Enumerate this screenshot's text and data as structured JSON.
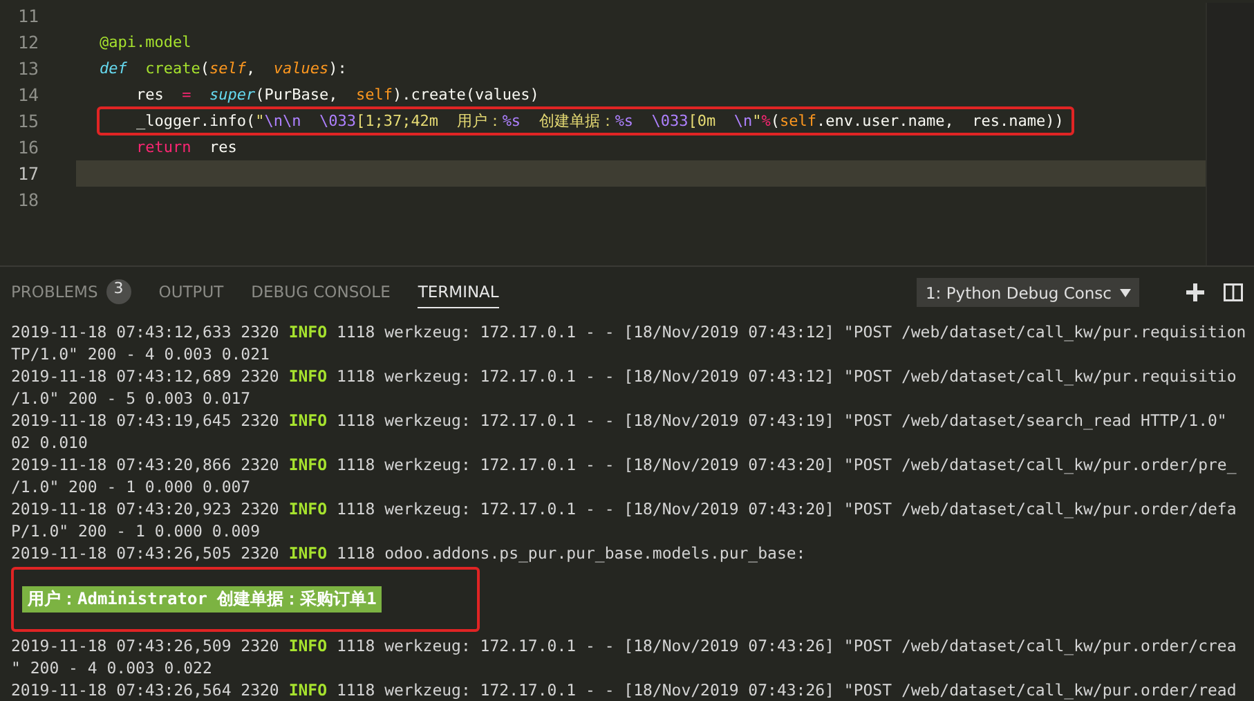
{
  "editor": {
    "lines": [
      {
        "number": "11",
        "current": false
      },
      {
        "number": "12",
        "current": false,
        "tokens": [
          {
            "t": "@api.model",
            "kind": "decorator"
          }
        ]
      },
      {
        "number": "13",
        "current": false,
        "tokens": [
          {
            "t": "def",
            "kind": "storage"
          },
          {
            "t": "  create",
            "kind": "function"
          },
          {
            "t": "(",
            "kind": "plain"
          },
          {
            "t": "self",
            "kind": "param"
          },
          {
            "t": ",  ",
            "kind": "plain"
          },
          {
            "t": "values",
            "kind": "param"
          },
          {
            "t": "):",
            "kind": "plain"
          }
        ]
      },
      {
        "number": "14",
        "current": false,
        "tokens": [
          {
            "t": "    res  ",
            "kind": "plain"
          },
          {
            "t": "=",
            "kind": "operator"
          },
          {
            "t": "  super",
            "kind": "storage"
          },
          {
            "t": "(PurBase,  ",
            "kind": "plain"
          },
          {
            "t": "self",
            "kind": "self"
          },
          {
            "t": ").create(values)",
            "kind": "plain"
          }
        ]
      },
      {
        "number": "15",
        "current": false,
        "highlighted": true,
        "tokens": [
          {
            "t": "    _logger.info(",
            "kind": "plain"
          },
          {
            "t": "\"",
            "kind": "string"
          },
          {
            "t": "\\n\\n  \\033",
            "kind": "escape"
          },
          {
            "t": "[1;37;42m  用户：",
            "kind": "string"
          },
          {
            "t": "%s",
            "kind": "escape"
          },
          {
            "t": "  创建单据：",
            "kind": "string"
          },
          {
            "t": "%s  \\033",
            "kind": "escape"
          },
          {
            "t": "[0m  ",
            "kind": "string"
          },
          {
            "t": "\\n",
            "kind": "escape"
          },
          {
            "t": "\"",
            "kind": "string"
          },
          {
            "t": "%",
            "kind": "operator"
          },
          {
            "t": "(",
            "kind": "plain"
          },
          {
            "t": "self",
            "kind": "self"
          },
          {
            "t": ".env.user.name,  res.name))",
            "kind": "plain"
          }
        ]
      },
      {
        "number": "16",
        "current": false,
        "tokens": [
          {
            "t": "    return",
            "kind": "operator"
          },
          {
            "t": "  res",
            "kind": "plain"
          }
        ]
      },
      {
        "number": "17",
        "current": true
      },
      {
        "number": "18",
        "current": false
      }
    ]
  },
  "panel": {
    "tabs": [
      {
        "label": "PROBLEMS",
        "badge": "3",
        "selected": false
      },
      {
        "label": "OUTPUT",
        "selected": false
      },
      {
        "label": "DEBUG CONSOLE",
        "selected": false
      },
      {
        "label": "TERMINAL",
        "selected": true
      }
    ],
    "terminal_select": "1: Python Debug Consc"
  },
  "terminal": [
    {
      "kind": "log",
      "head": "2019-11-18 07:43:12,633 2320",
      "level": "INFO",
      "rest": "1118 werkzeug: 172.17.0.1 - - [18/Nov/2019 07:43:12] \"POST /web/dataset/call_kw/pur.requisition",
      "wrap": "TP/1.0\" 200 - 4 0.003 0.021"
    },
    {
      "kind": "log",
      "head": "2019-11-18 07:43:12,689 2320",
      "level": "INFO",
      "rest": "1118 werkzeug: 172.17.0.1 - - [18/Nov/2019 07:43:12] \"POST /web/dataset/call_kw/pur.requisitio",
      "wrap": "/1.0\" 200 - 5 0.003 0.017"
    },
    {
      "kind": "log",
      "head": "2019-11-18 07:43:19,645 2320",
      "level": "INFO",
      "rest": "1118 werkzeug: 172.17.0.1 - - [18/Nov/2019 07:43:19] \"POST /web/dataset/search_read HTTP/1.0\"",
      "wrap": "02 0.010"
    },
    {
      "kind": "log",
      "head": "2019-11-18 07:43:20,866 2320",
      "level": "INFO",
      "rest": "1118 werkzeug: 172.17.0.1 - - [18/Nov/2019 07:43:20] \"POST /web/dataset/call_kw/pur.order/pre_",
      "wrap": "/1.0\" 200 - 1 0.000 0.007"
    },
    {
      "kind": "log",
      "head": "2019-11-18 07:43:20,923 2320",
      "level": "INFO",
      "rest": "1118 werkzeug: 172.17.0.1 - - [18/Nov/2019 07:43:20] \"POST /web/dataset/call_kw/pur.order/defa",
      "wrap": "P/1.0\" 200 - 1 0.000 0.009"
    },
    {
      "kind": "log",
      "head": "2019-11-18 07:43:26,505 2320",
      "level": "INFO",
      "rest": "1118 odoo.addons.ps_pur.pur_base.models.pur_base:"
    },
    {
      "kind": "banner",
      "text": "用户：Administrator 创建单据：采购订单1",
      "highlighted": true
    },
    {
      "kind": "log",
      "head": "2019-11-18 07:43:26,509 2320",
      "level": "INFO",
      "rest": "1118 werkzeug: 172.17.0.1 - - [18/Nov/2019 07:43:26] \"POST /web/dataset/call_kw/pur.order/crea",
      "wrap": "\" 200 - 4 0.003 0.022"
    },
    {
      "kind": "log",
      "head": "2019-11-18 07:43:26,564 2320",
      "level": "INFO",
      "rest": "1118 werkzeug: 172.17.0.1 - - [18/Nov/2019 07:43:26] \"POST /web/dataset/call_kw/pur.order/read"
    }
  ]
}
